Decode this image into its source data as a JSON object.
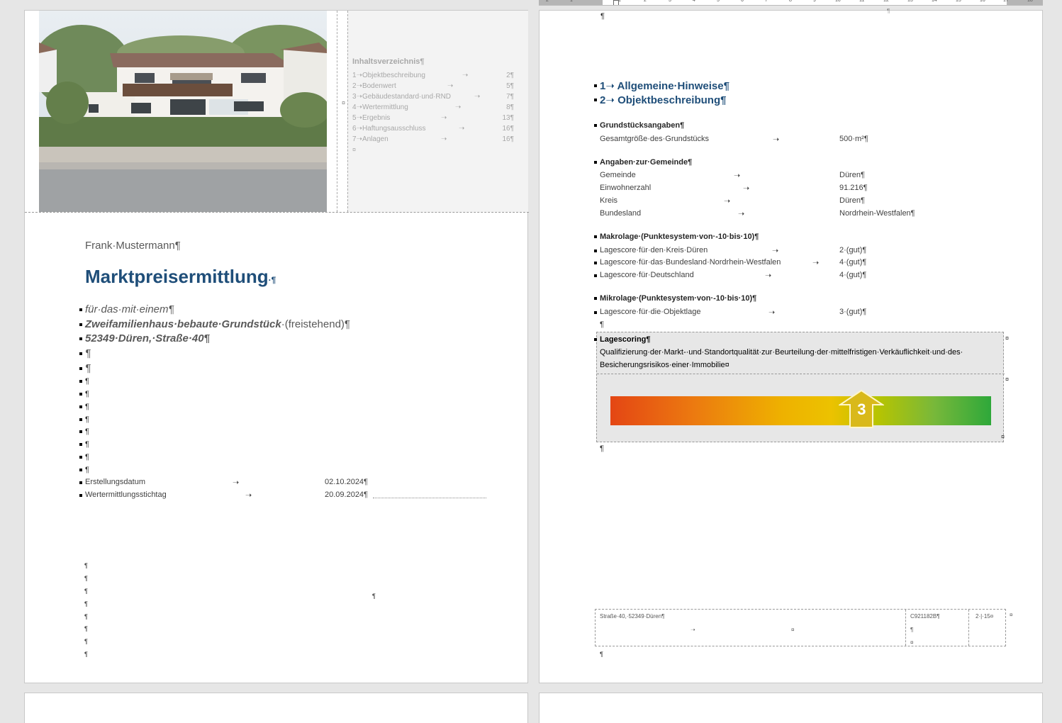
{
  "page1": {
    "toc": {
      "title": "Inhaltsverzeichnis¶",
      "items": [
        {
          "num": "1",
          "label": "Objektbeschreibung",
          "page": "2¶"
        },
        {
          "num": "2",
          "label": "Bodenwert",
          "page": "5¶"
        },
        {
          "num": "3",
          "label": "Gebäudestandard·und·RND",
          "page": "7¶"
        },
        {
          "num": "4",
          "label": "Wertermittlung",
          "page": "8¶"
        },
        {
          "num": "5",
          "label": "Ergebnis",
          "page": "13¶"
        },
        {
          "num": "6",
          "label": "Haftungsausschluss",
          "page": "16¶"
        },
        {
          "num": "7",
          "label": "Anlagen",
          "page": "16¶"
        }
      ],
      "end_mark": "¤",
      "cell_mark": "¤"
    },
    "author": "Frank·Mustermann¶",
    "title": "Marktpreisermittlung",
    "title_mark": "·¶",
    "subtitle1": "für·das·mit·einem¶",
    "subtitle2_bold": "Zweifamilienhaus·bebaute·Grundstück",
    "subtitle2_rest": "·(freistehend)¶",
    "address": "52349·Düren,·Straße·40¶",
    "pilcrow": "¶",
    "dates": [
      {
        "label": "Erstellungsdatum",
        "value": "02.10.2024¶"
      },
      {
        "label": "Wertermittlungsstichtag",
        "value": "20.09.2024¶"
      }
    ]
  },
  "page2": {
    "ruler_numbers": [
      "2",
      "1",
      "1",
      "2",
      "3",
      "4",
      "5",
      "6",
      "7",
      "8",
      "9",
      "10",
      "11",
      "12",
      "13",
      "14",
      "15",
      "16",
      "17",
      "18"
    ],
    "headings": [
      {
        "num": "1",
        "text": "Allgemeine·Hinweise¶"
      },
      {
        "num": "2",
        "text": "Objektbeschreibung¶"
      }
    ],
    "grundstueck": {
      "title": "Grundstücksangaben¶",
      "rows": [
        {
          "label": "Gesamtgröße·des·Grundstücks",
          "value": "500·m²¶"
        }
      ]
    },
    "gemeinde": {
      "title": "Angaben·zur·Gemeinde¶",
      "rows": [
        {
          "label": "Gemeinde",
          "value": "Düren¶"
        },
        {
          "label": "Einwohnerzahl",
          "value": "91.216¶"
        },
        {
          "label": "Kreis",
          "value": "Düren¶"
        },
        {
          "label": "Bundesland",
          "value": "Nordrhein-Westfalen¶"
        }
      ]
    },
    "makrolage": {
      "title": "Makrolage·(Punktesystem·von·-10·bis·10)¶",
      "rows": [
        {
          "label": "Lagescore·für·den·Kreis·Düren",
          "value": "2·(gut)¶"
        },
        {
          "label": "Lagescore·für·das·Bundesland·Nordrhein-Westfalen",
          "value": "4·(gut)¶"
        },
        {
          "label": "Lagescore·für·Deutschland",
          "value": "4·(gut)¶"
        }
      ]
    },
    "mikrolage": {
      "title": "Mikrolage·(Punktesystem·von·-10·bis·10)¶",
      "rows": [
        {
          "label": "Lagescore·für·die·Objektlage",
          "value": "3·(gut)¶"
        }
      ]
    },
    "lagescoring": {
      "title": "Lagescoring¶",
      "desc1": "Qualifizierung·der·Markt-·und·Standortqualität·zur·Beurteilung·der·mittelfristigen·Verkäuflichkeit·und·des·",
      "desc2": "Besicherungsrisikos·einer·Immobilie¤",
      "score": "3",
      "score_fraction": 0.66
    },
    "footer": {
      "address": "Straße·40,·52349·Düren¶",
      "code": "C921182B¶",
      "page": "2·|·15¤",
      "cell_mark": "¤"
    },
    "pilcrow": "¶"
  },
  "colors": {
    "heading_blue": "#1f4e79",
    "score_arrow": "#d9b91a"
  }
}
